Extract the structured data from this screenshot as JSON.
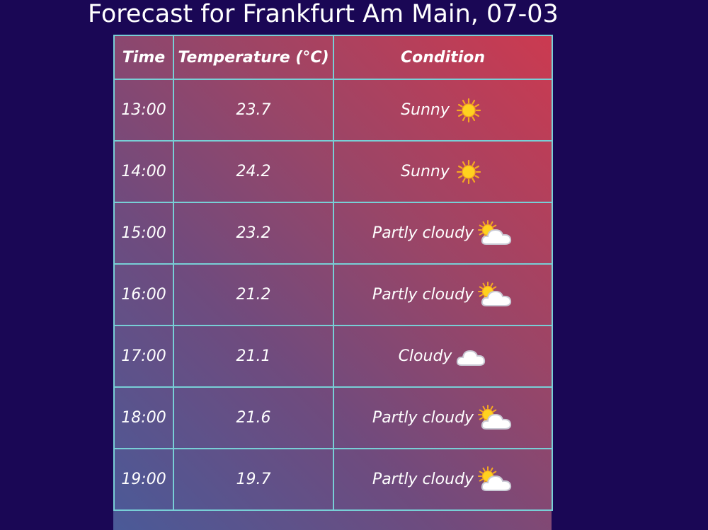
{
  "page": {
    "title": "Forecast for Frankfurt Am Main, 07-03"
  },
  "table": {
    "headers": {
      "time": "Time",
      "temperature": "Temperature (°C)",
      "condition": "Condition"
    },
    "rows": [
      {
        "time": "13:00",
        "temperature": "23.7",
        "condition": "Sunny",
        "icon": "sun-icon"
      },
      {
        "time": "14:00",
        "temperature": "24.2",
        "condition": "Sunny",
        "icon": "sun-icon"
      },
      {
        "time": "15:00",
        "temperature": "23.2",
        "condition": "Partly cloudy",
        "icon": "partly-cloudy-icon"
      },
      {
        "time": "16:00",
        "temperature": "21.2",
        "condition": "Partly cloudy",
        "icon": "partly-cloudy-icon"
      },
      {
        "time": "17:00",
        "temperature": "21.1",
        "condition": "Cloudy",
        "icon": "cloud-icon"
      },
      {
        "time": "18:00",
        "temperature": "21.6",
        "condition": "Partly cloudy",
        "icon": "partly-cloudy-icon"
      },
      {
        "time": "19:00",
        "temperature": "19.7",
        "condition": "Partly cloudy",
        "icon": "partly-cloudy-icon"
      }
    ]
  },
  "colors": {
    "background": "#1a0755",
    "border": "#78cfd6",
    "gradient_top_right": "#cc3a50",
    "gradient_bottom_left": "#4a5a98"
  }
}
